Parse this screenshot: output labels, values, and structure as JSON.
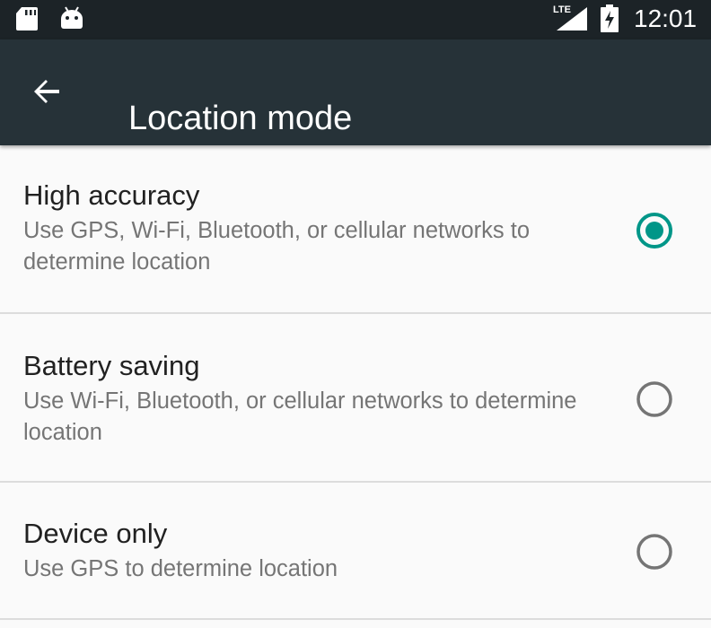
{
  "status_bar": {
    "network_label": "LTE",
    "time": "12:01",
    "icons": [
      "sd-card-icon",
      "android-icon",
      "signal-icon",
      "battery-charging-icon"
    ]
  },
  "app_bar": {
    "back_icon": "arrow-back-icon",
    "title": "Location mode"
  },
  "options": [
    {
      "label": "High accuracy",
      "description": "Use GPS, Wi-Fi, Bluetooth, or cellular networks to determine location",
      "selected": true
    },
    {
      "label": "Battery saving",
      "description": "Use Wi-Fi, Bluetooth, or cellular networks to determine location",
      "selected": false
    },
    {
      "label": "Device only",
      "description": "Use GPS to determine location",
      "selected": false
    }
  ],
  "colors": {
    "status_bar": "#1c2327",
    "app_bar": "#263238",
    "accent": "#009688",
    "radio_off": "#757575",
    "background": "#fafafa"
  }
}
